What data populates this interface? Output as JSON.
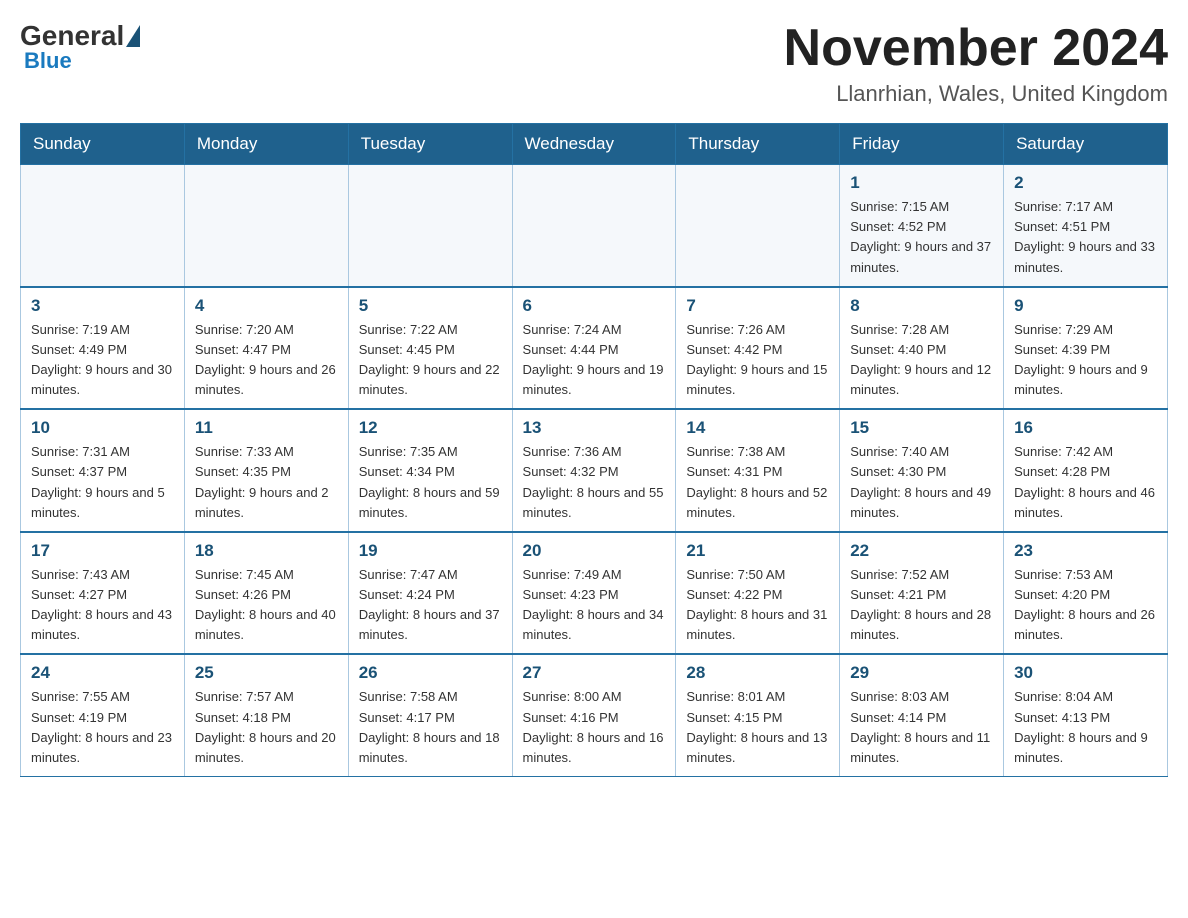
{
  "header": {
    "logo": {
      "general": "General",
      "blue": "Blue"
    },
    "title": "November 2024",
    "location": "Llanrhian, Wales, United Kingdom"
  },
  "calendar": {
    "days_of_week": [
      "Sunday",
      "Monday",
      "Tuesday",
      "Wednesday",
      "Thursday",
      "Friday",
      "Saturday"
    ],
    "weeks": [
      [
        {
          "day": "",
          "info": ""
        },
        {
          "day": "",
          "info": ""
        },
        {
          "day": "",
          "info": ""
        },
        {
          "day": "",
          "info": ""
        },
        {
          "day": "",
          "info": ""
        },
        {
          "day": "1",
          "info": "Sunrise: 7:15 AM\nSunset: 4:52 PM\nDaylight: 9 hours and 37 minutes."
        },
        {
          "day": "2",
          "info": "Sunrise: 7:17 AM\nSunset: 4:51 PM\nDaylight: 9 hours and 33 minutes."
        }
      ],
      [
        {
          "day": "3",
          "info": "Sunrise: 7:19 AM\nSunset: 4:49 PM\nDaylight: 9 hours and 30 minutes."
        },
        {
          "day": "4",
          "info": "Sunrise: 7:20 AM\nSunset: 4:47 PM\nDaylight: 9 hours and 26 minutes."
        },
        {
          "day": "5",
          "info": "Sunrise: 7:22 AM\nSunset: 4:45 PM\nDaylight: 9 hours and 22 minutes."
        },
        {
          "day": "6",
          "info": "Sunrise: 7:24 AM\nSunset: 4:44 PM\nDaylight: 9 hours and 19 minutes."
        },
        {
          "day": "7",
          "info": "Sunrise: 7:26 AM\nSunset: 4:42 PM\nDaylight: 9 hours and 15 minutes."
        },
        {
          "day": "8",
          "info": "Sunrise: 7:28 AM\nSunset: 4:40 PM\nDaylight: 9 hours and 12 minutes."
        },
        {
          "day": "9",
          "info": "Sunrise: 7:29 AM\nSunset: 4:39 PM\nDaylight: 9 hours and 9 minutes."
        }
      ],
      [
        {
          "day": "10",
          "info": "Sunrise: 7:31 AM\nSunset: 4:37 PM\nDaylight: 9 hours and 5 minutes."
        },
        {
          "day": "11",
          "info": "Sunrise: 7:33 AM\nSunset: 4:35 PM\nDaylight: 9 hours and 2 minutes."
        },
        {
          "day": "12",
          "info": "Sunrise: 7:35 AM\nSunset: 4:34 PM\nDaylight: 8 hours and 59 minutes."
        },
        {
          "day": "13",
          "info": "Sunrise: 7:36 AM\nSunset: 4:32 PM\nDaylight: 8 hours and 55 minutes."
        },
        {
          "day": "14",
          "info": "Sunrise: 7:38 AM\nSunset: 4:31 PM\nDaylight: 8 hours and 52 minutes."
        },
        {
          "day": "15",
          "info": "Sunrise: 7:40 AM\nSunset: 4:30 PM\nDaylight: 8 hours and 49 minutes."
        },
        {
          "day": "16",
          "info": "Sunrise: 7:42 AM\nSunset: 4:28 PM\nDaylight: 8 hours and 46 minutes."
        }
      ],
      [
        {
          "day": "17",
          "info": "Sunrise: 7:43 AM\nSunset: 4:27 PM\nDaylight: 8 hours and 43 minutes."
        },
        {
          "day": "18",
          "info": "Sunrise: 7:45 AM\nSunset: 4:26 PM\nDaylight: 8 hours and 40 minutes."
        },
        {
          "day": "19",
          "info": "Sunrise: 7:47 AM\nSunset: 4:24 PM\nDaylight: 8 hours and 37 minutes."
        },
        {
          "day": "20",
          "info": "Sunrise: 7:49 AM\nSunset: 4:23 PM\nDaylight: 8 hours and 34 minutes."
        },
        {
          "day": "21",
          "info": "Sunrise: 7:50 AM\nSunset: 4:22 PM\nDaylight: 8 hours and 31 minutes."
        },
        {
          "day": "22",
          "info": "Sunrise: 7:52 AM\nSunset: 4:21 PM\nDaylight: 8 hours and 28 minutes."
        },
        {
          "day": "23",
          "info": "Sunrise: 7:53 AM\nSunset: 4:20 PM\nDaylight: 8 hours and 26 minutes."
        }
      ],
      [
        {
          "day": "24",
          "info": "Sunrise: 7:55 AM\nSunset: 4:19 PM\nDaylight: 8 hours and 23 minutes."
        },
        {
          "day": "25",
          "info": "Sunrise: 7:57 AM\nSunset: 4:18 PM\nDaylight: 8 hours and 20 minutes."
        },
        {
          "day": "26",
          "info": "Sunrise: 7:58 AM\nSunset: 4:17 PM\nDaylight: 8 hours and 18 minutes."
        },
        {
          "day": "27",
          "info": "Sunrise: 8:00 AM\nSunset: 4:16 PM\nDaylight: 8 hours and 16 minutes."
        },
        {
          "day": "28",
          "info": "Sunrise: 8:01 AM\nSunset: 4:15 PM\nDaylight: 8 hours and 13 minutes."
        },
        {
          "day": "29",
          "info": "Sunrise: 8:03 AM\nSunset: 4:14 PM\nDaylight: 8 hours and 11 minutes."
        },
        {
          "day": "30",
          "info": "Sunrise: 8:04 AM\nSunset: 4:13 PM\nDaylight: 8 hours and 9 minutes."
        }
      ]
    ]
  }
}
